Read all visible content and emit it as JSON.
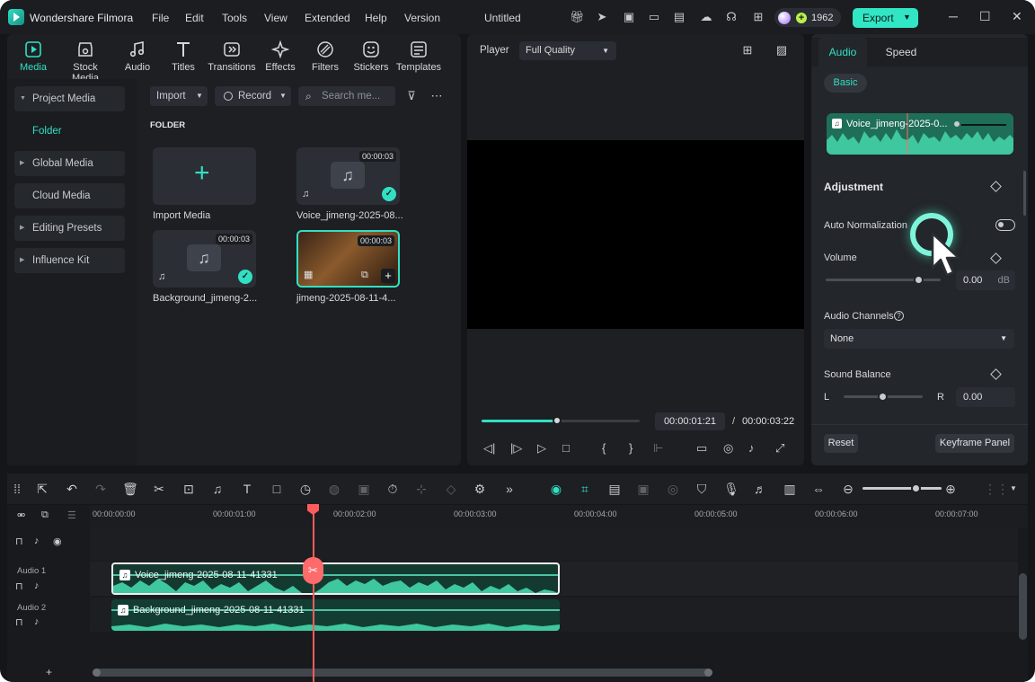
{
  "titlebar": {
    "app_name": "Wondershare Filmora",
    "menu": [
      "File",
      "Edit",
      "Tools",
      "View",
      "Extended",
      "Help",
      "Version"
    ],
    "doc_title": "Untitled",
    "credits": "1962",
    "export_label": "Export"
  },
  "media_tabs": [
    "Media",
    "Stock Media",
    "Audio",
    "Titles",
    "Transitions",
    "Effects",
    "Filters",
    "Stickers",
    "Templates"
  ],
  "sidebar": {
    "items": [
      {
        "label": "Project Media",
        "arrow": "▼"
      },
      {
        "label": "Folder",
        "arrow": ""
      },
      {
        "label": "Global Media",
        "arrow": "▶"
      },
      {
        "label": "Cloud Media",
        "arrow": ""
      },
      {
        "label": "Editing Presets",
        "arrow": "▶"
      },
      {
        "label": "Influence Kit",
        "arrow": "▶"
      }
    ]
  },
  "media_toolbar": {
    "import": "Import",
    "record": "Record",
    "search_placeholder": "Search me..."
  },
  "folder_label": "FOLDER",
  "media_items": [
    {
      "label": "Import Media"
    },
    {
      "label": "Voice_jimeng-2025-08...",
      "duration": "00:00:03"
    },
    {
      "label": "Background_jimeng-2...",
      "duration": "00:00:03"
    },
    {
      "label": "jimeng-2025-08-11-4...",
      "duration": "00:00:03"
    }
  ],
  "player": {
    "label": "Player",
    "quality": "Full Quality",
    "current_time": "00:00:01:21",
    "separator": "/",
    "total_time": "00:00:03:22",
    "progress_fraction": 0.48
  },
  "right_panel": {
    "tabs": [
      "Audio",
      "Speed"
    ],
    "subtab": "Basic",
    "clip_name": "Voice_jimeng-2025-0...",
    "section": "Adjustment",
    "auto_normalization": "Auto Normalization",
    "volume_label": "Volume",
    "volume_value": "0.00",
    "volume_unit": "dB",
    "channels_label": "Audio Channels",
    "channels_value": "None",
    "balance_label": "Sound Balance",
    "balance_left": "L",
    "balance_right": "R",
    "balance_value": "0.00",
    "reset": "Reset",
    "keyframe": "Keyframe Panel"
  },
  "timeline": {
    "ruler": [
      "00:00:00:00",
      "00:00:01:00",
      "00:00:02:00",
      "00:00:03:00",
      "00:00:04:00",
      "00:00:05:00",
      "00:00:06:00",
      "00:00:07:00"
    ],
    "tracks": [
      {
        "label": "Audio 1"
      },
      {
        "label": "Audio 2"
      }
    ],
    "clips": [
      {
        "label": "Voice_jimeng-2025-08-11-41331"
      },
      {
        "label": "Background_jimeng-2025-08-11-41331"
      }
    ],
    "add_track": "+"
  },
  "colors": {
    "accent": "#31e0c3",
    "playhead": "#ff5c5c",
    "audio_clip": "#1f6e58"
  }
}
